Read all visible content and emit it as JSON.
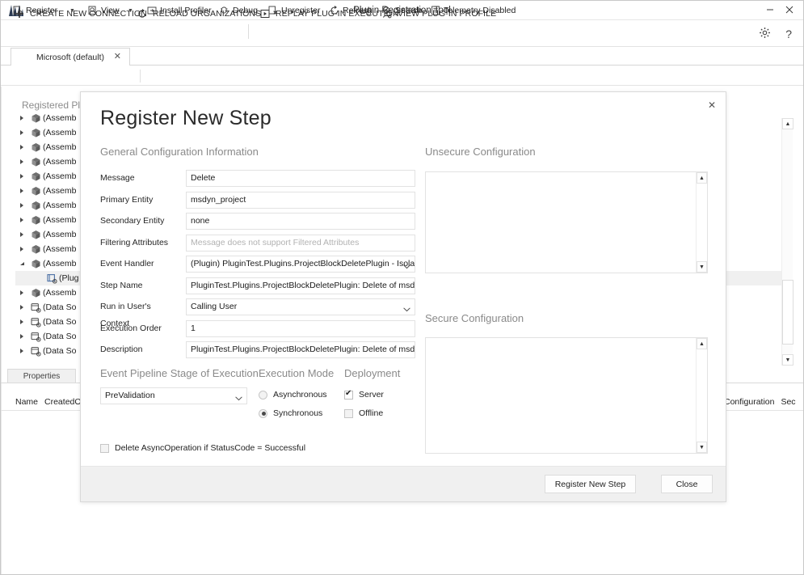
{
  "window": {
    "title": "Plugin Registration Tool",
    "logo_icon": "app-logo-icon",
    "minimize_label": "—",
    "close_label": "✕"
  },
  "commandbar": {
    "items": [
      {
        "label": "CREATE NEW CONNECTION",
        "icon": "plus-icon"
      },
      {
        "label": "RELOAD ORGANIZATIONS",
        "icon": "refresh-circle-icon"
      },
      {
        "label": "REPLAY PLUG-IN EXECUTION",
        "icon": "play-box-icon"
      },
      {
        "label": "VIEW PLUG-IN PROFILE",
        "icon": "profile-icon"
      }
    ],
    "settings_icon": "gear-icon",
    "help_icon": "help-icon",
    "settings_glyph": "⚙",
    "help_glyph": "?"
  },
  "tabs": [
    {
      "label": "Microsoft (default)",
      "close_glyph": "✕"
    }
  ],
  "toolbar": {
    "items": [
      {
        "label": "Register",
        "icon": "register-icon",
        "has_caret": true
      },
      {
        "label": "View",
        "icon": "view-icon",
        "has_caret": true
      },
      {
        "label": "Install Profiler",
        "icon": "install-profiler-icon",
        "has_caret": false
      },
      {
        "label": "Debug",
        "icon": "debug-icon",
        "has_caret": false
      },
      {
        "label": "Unregister",
        "icon": "unregister-icon",
        "has_caret": false
      },
      {
        "label": "Refresh",
        "icon": "refresh-icon",
        "has_caret": false
      },
      {
        "label": "Search",
        "icon": "search-icon",
        "has_caret": false
      },
      {
        "label": "Telemetry Disabled",
        "icon": "telemetry-icon",
        "has_caret": false
      }
    ],
    "caret_glyph": "▼"
  },
  "main": {
    "panel_heading": "Registered Plu",
    "tree_rows": [
      {
        "label": "(Assemb",
        "icon": "assembly-icon",
        "expander": "collapsed",
        "indent": 0,
        "selected": false
      },
      {
        "label": "(Assemb",
        "icon": "assembly-icon",
        "expander": "collapsed",
        "indent": 0,
        "selected": false
      },
      {
        "label": "(Assemb",
        "icon": "assembly-icon",
        "expander": "collapsed",
        "indent": 0,
        "selected": false
      },
      {
        "label": "(Assemb",
        "icon": "assembly-icon",
        "expander": "collapsed",
        "indent": 0,
        "selected": false
      },
      {
        "label": "(Assemb",
        "icon": "assembly-icon",
        "expander": "collapsed",
        "indent": 0,
        "selected": false
      },
      {
        "label": "(Assemb",
        "icon": "assembly-icon",
        "expander": "collapsed",
        "indent": 0,
        "selected": false
      },
      {
        "label": "(Assemb",
        "icon": "assembly-icon",
        "expander": "collapsed",
        "indent": 0,
        "selected": false
      },
      {
        "label": "(Assemb",
        "icon": "assembly-icon",
        "expander": "collapsed",
        "indent": 0,
        "selected": false
      },
      {
        "label": "(Assemb",
        "icon": "assembly-icon",
        "expander": "collapsed",
        "indent": 0,
        "selected": false
      },
      {
        "label": "(Assemb",
        "icon": "assembly-icon",
        "expander": "collapsed",
        "indent": 0,
        "selected": false
      },
      {
        "label": "(Assemb",
        "icon": "assembly-icon",
        "expander": "expanded",
        "indent": 0,
        "selected": false
      },
      {
        "label": "(Plug",
        "icon": "plugin-icon",
        "expander": "none",
        "indent": 1,
        "selected": true
      },
      {
        "label": "(Assemb",
        "icon": "assembly-icon",
        "expander": "collapsed",
        "indent": 0,
        "selected": false
      },
      {
        "label": "(Data So",
        "icon": "datasource-icon",
        "expander": "collapsed",
        "indent": 0,
        "selected": false
      },
      {
        "label": "(Data So",
        "icon": "datasource-icon",
        "expander": "collapsed",
        "indent": 0,
        "selected": false
      },
      {
        "label": "(Data So",
        "icon": "datasource-icon",
        "expander": "collapsed",
        "indent": 0,
        "selected": false
      },
      {
        "label": "(Data So",
        "icon": "datasource-icon",
        "expander": "collapsed",
        "indent": 0,
        "selected": false
      }
    ],
    "properties_tab": "Properties",
    "grid_columns_left": [
      "Name",
      "CreatedO"
    ],
    "grid_columns_right": [
      "Configuration",
      "Sec"
    ],
    "scrollbar": {
      "up_glyph": "▲",
      "down_glyph": "▼"
    }
  },
  "dialog": {
    "title": "Register New Step",
    "close_glyph": "✕",
    "general_section_title": "General Configuration Information",
    "fields": [
      {
        "label": "Message",
        "value": "Delete",
        "placeholder": "",
        "type": "text"
      },
      {
        "label": "Primary Entity",
        "value": "msdyn_project",
        "placeholder": "",
        "type": "text"
      },
      {
        "label": "Secondary Entity",
        "value": "none",
        "placeholder": "",
        "type": "text"
      },
      {
        "label": "Filtering Attributes",
        "value": "",
        "placeholder": "Message does not support Filtered Attributes",
        "type": "text"
      },
      {
        "label": "Event Handler",
        "value": "(Plugin) PluginTest.Plugins.ProjectBlockDeletePlugin - Isolatab",
        "placeholder": "",
        "type": "combo"
      },
      {
        "label": "Step Name",
        "value": "PluginTest.Plugins.ProjectBlockDeletePlugin: Delete of msdyn_proj",
        "placeholder": "",
        "type": "text"
      },
      {
        "label": "Run in User's Context",
        "value": "Calling User",
        "placeholder": "",
        "type": "combo"
      },
      {
        "label": "Execution Order",
        "value": "1",
        "placeholder": "",
        "type": "text"
      },
      {
        "label": "Description",
        "value": "PluginTest.Plugins.ProjectBlockDeletePlugin: Delete of msdyn_proj",
        "placeholder": "",
        "type": "text"
      }
    ],
    "stage": {
      "title": "Event Pipeline Stage of Execution",
      "value": "PreValidation",
      "caret_glyph": "⌄"
    },
    "execution_mode": {
      "title": "Execution Mode",
      "options": [
        {
          "label": "Asynchronous",
          "selected": false
        },
        {
          "label": "Synchronous",
          "selected": true
        }
      ]
    },
    "deployment": {
      "title": "Deployment",
      "options": [
        {
          "label": "Server",
          "checked": true
        },
        {
          "label": "Offline",
          "checked": false
        }
      ]
    },
    "delete_async": {
      "label": "Delete AsyncOperation if StatusCode = Successful",
      "checked": false
    },
    "unsecure_configuration": {
      "title": "Unsecure  Configuration",
      "value": ""
    },
    "secure_configuration": {
      "title": "Secure  Configuration",
      "value": ""
    },
    "scroll_glyphs": {
      "up": "▲",
      "down": "▼"
    },
    "buttons": {
      "primary": "Register New Step",
      "secondary": "Close"
    }
  },
  "colors": {
    "window_bg": "#ffffff",
    "dialog_bg": "#ffffff",
    "footer_bg": "#f0f0f0",
    "border": "#d9d9d9",
    "muted_text": "#8a8a8a",
    "text": "#1f1f1f"
  }
}
